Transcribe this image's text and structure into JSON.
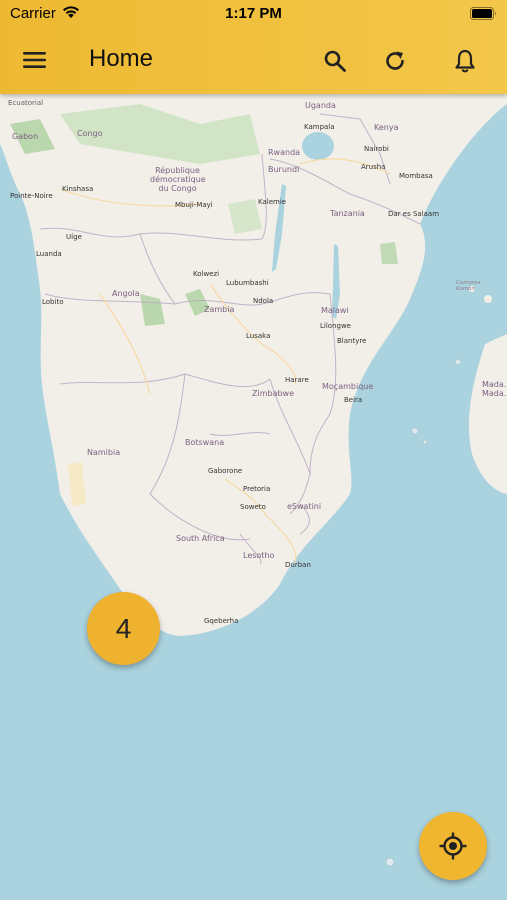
{
  "status_bar": {
    "carrier": "Carrier",
    "time": "1:17 PM"
  },
  "header": {
    "title": "Home"
  },
  "icons": {
    "menu": "hamburger-menu-icon",
    "search": "search-icon",
    "refresh": "refresh-icon",
    "notifications": "bell-icon",
    "locate": "crosshair-locate-icon"
  },
  "colors": {
    "accent": "#eeb22e",
    "sea": "#aad3df",
    "land": "#f2efe9"
  },
  "cluster": {
    "count": "4"
  },
  "map_labels": {
    "ecuatorial": "Ecuatorial",
    "gabon": "Gabon",
    "congo": "Congo",
    "pointe_noire": "Pointe-Noire",
    "kinshasa": "Kinshasa",
    "drc": "République démocratique du Congo",
    "mbuji_mayi": "Mbuji-Mayi",
    "uige": "Uíge",
    "luanda": "Luanda",
    "angola": "Angola",
    "lobito": "Lobito",
    "zambia": "Zambia",
    "kolwezi": "Kolwezi",
    "lubumbashi": "Lubumbashi",
    "ndola": "Ndola",
    "lusaka": "Lusaka",
    "uganda": "Uganda",
    "kampala": "Kampala",
    "kenya": "Kenya",
    "nairobi": "Nairobi",
    "arusha": "Arusha",
    "mombasa": "Mombasa",
    "rwanda": "Rwanda",
    "burundi": "Burundi",
    "kalemie": "Kalemie",
    "tanzania": "Tanzania",
    "dar_es_salaam": "Dar es Salaam",
    "malawi": "Malawi",
    "lilongwe": "Lilongwe",
    "blantyre": "Blantyre",
    "mocambique": "Moçambique",
    "harare": "Harare",
    "zimbabwe": "Zimbabwe",
    "beira": "Beira",
    "namibia": "Namibia",
    "botswana": "Botswana",
    "gaborone": "Gaborone",
    "pretoria": "Pretoria",
    "soweto": "Soweto",
    "eswatini": "eSwatini",
    "south_africa": "South Africa",
    "lesotho": "Lesotho",
    "durban": "Durban",
    "gqeberha": "Gqeberha",
    "comores": "Comores Komori",
    "madagascar": "Mada... Mada..."
  }
}
